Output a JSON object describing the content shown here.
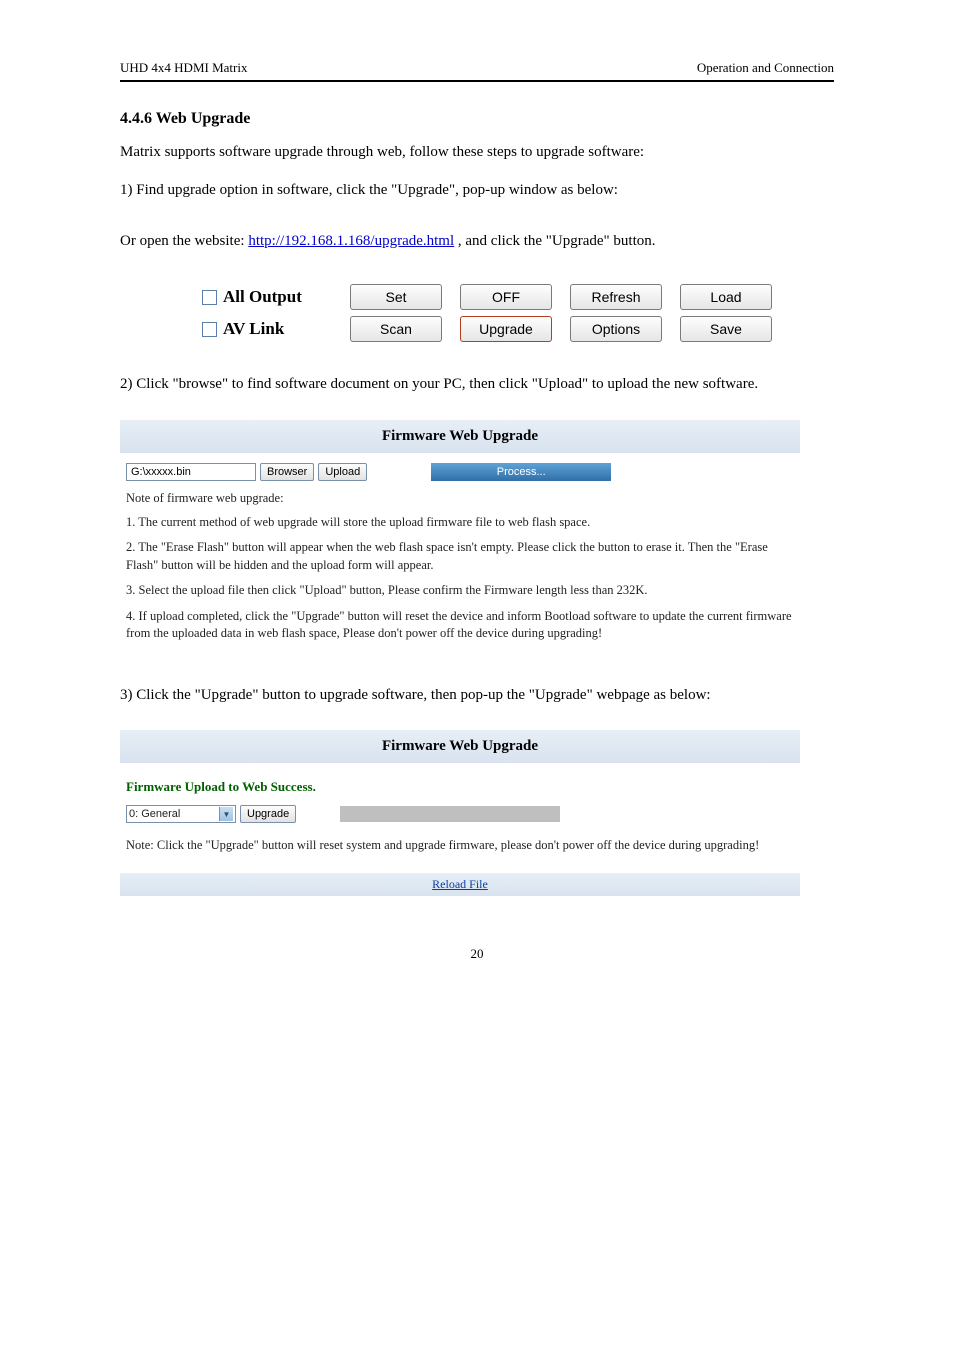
{
  "header": {
    "left": "UHD 4x4 HDMI Matrix",
    "right": "Operation and Connection"
  },
  "sec": {
    "web_upgrade_heading": "4.4.6 Web Upgrade",
    "wu_intro": "Matrix supports software upgrade through web, follow these steps to upgrade software:",
    "wu_step1_a": "1) Find upgrade option in software, click the \"Upgrade\", pop-up window as below:",
    "wu_step1_link": "http://192.168.1.168/upgrade.html",
    "link_prefix": "Or open the website: ",
    "link_suffix": ", and click the \"Upgrade\" button.",
    "wu_step2": "2) Click \"browse\" to find software document on your PC, then click \"Upload\" to upload the new software.",
    "wu_step3": "3) Click the \"Upgrade\" button to upgrade software, then pop-up the \"Upgrade\" webpage as below:"
  },
  "btns": {
    "all_output": "All Output",
    "av_link": "AV Link",
    "set": "Set",
    "scan": "Scan",
    "off": "OFF",
    "upgrade": "Upgrade",
    "refresh": "Refresh",
    "options": "Options",
    "load": "Load",
    "save": "Save"
  },
  "fw1": {
    "title": "Firmware Web Upgrade",
    "file": "G:\\xxxxx.bin",
    "browser": "Browser",
    "upload": "Upload",
    "process": "Process...",
    "note_hd": "Note of firmware web upgrade:",
    "n1": "1. The current method of web upgrade will store the upload firmware file to web flash space.",
    "n2": "2. The \"Erase Flash\" button will appear when the web flash space isn't empty. Please click the button to erase it. Then the \"Erase Flash\" button will be hidden and the upload form will appear.",
    "n3": "3. Select the upload file then click \"Upload\" button, Please confirm the Firmware length less than 232K.",
    "n4": "4. If upload completed, click the \"Upgrade\" button will reset the device and inform Bootload software to update the current firmware from the uploaded data in web flash space, Please don't power off the device during upgrading!"
  },
  "fw2": {
    "title": "Firmware Web Upgrade",
    "success": "Firmware Upload to Web Success.",
    "sel": "0: General",
    "upgrade": "Upgrade",
    "note": "Note: Click the \"Upgrade\" button will reset system and upgrade firmware, please don't power off the device during upgrading!",
    "reload": "Reload File"
  },
  "footer": {
    "page": "20"
  }
}
